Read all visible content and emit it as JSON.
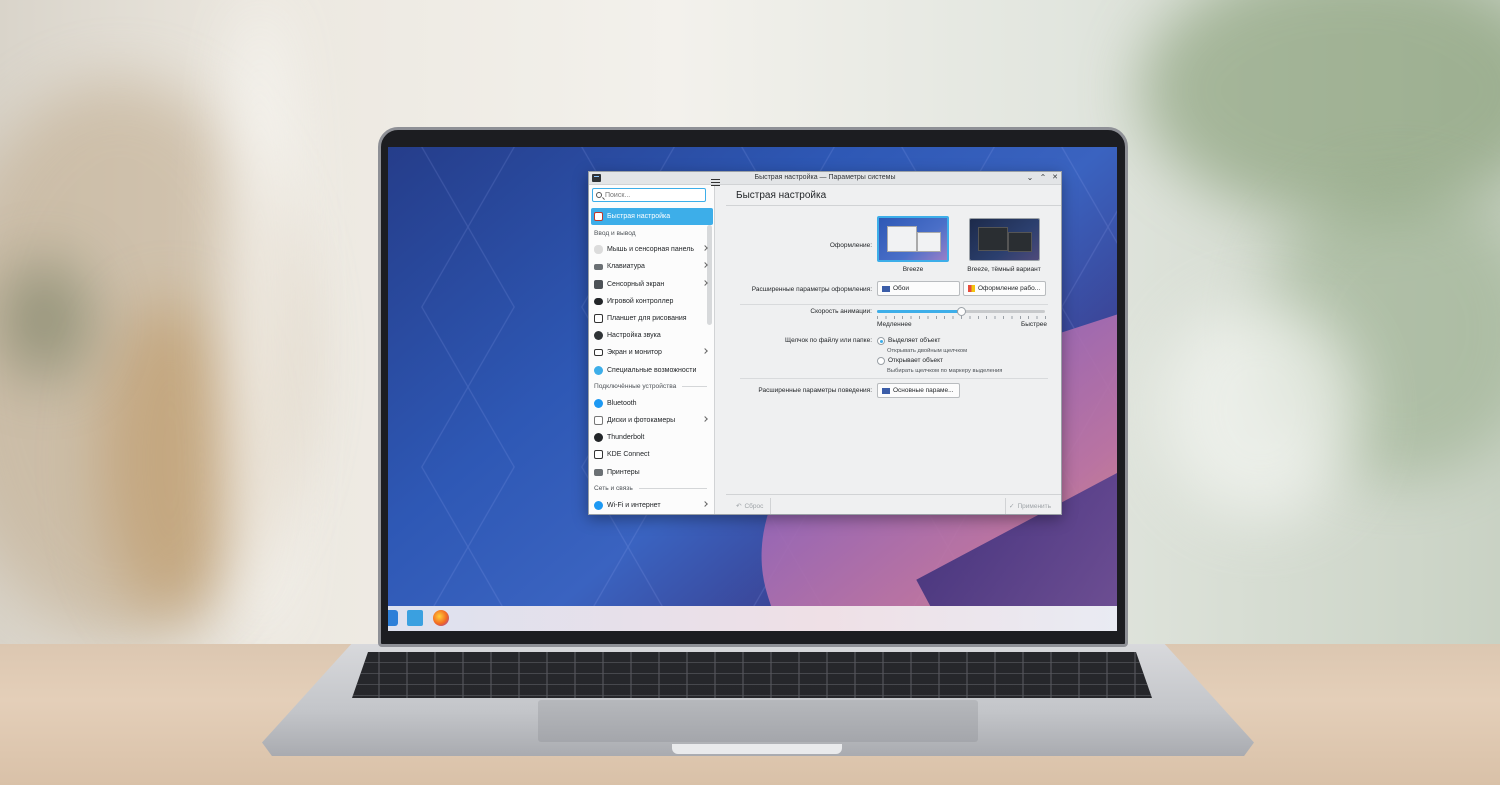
{
  "window": {
    "title": "Быстрая настройка — Параметры системы",
    "minimize": "⌄",
    "maximize": "⌃",
    "close": "✕"
  },
  "search": {
    "placeholder": "Поиск..."
  },
  "sidebar": {
    "active_item": "Быстрая настройка",
    "sections": [
      {
        "title": "Ввод и вывод",
        "items": [
          {
            "label": "Мышь и сенсорная панель",
            "icon": "mouse-icon",
            "has_submenu": true
          },
          {
            "label": "Клавиатура",
            "icon": "keyboard-icon",
            "has_submenu": true
          },
          {
            "label": "Сенсорный экран",
            "icon": "touchscreen-icon",
            "has_submenu": true
          },
          {
            "label": "Игровой контроллер",
            "icon": "gamepad-icon",
            "has_submenu": false
          },
          {
            "label": "Планшет для рисования",
            "icon": "tablet-icon",
            "has_submenu": false
          },
          {
            "label": "Настройка звука",
            "icon": "speaker-icon",
            "has_submenu": false
          },
          {
            "label": "Экран и монитор",
            "icon": "monitor-icon",
            "has_submenu": true
          },
          {
            "label": "Специальные возможности",
            "icon": "accessibility-icon",
            "has_submenu": false
          }
        ]
      },
      {
        "title": "Подключённые устройства",
        "items": [
          {
            "label": "Bluetooth",
            "icon": "bluetooth-icon",
            "has_submenu": false
          },
          {
            "label": "Диски и фотокамеры",
            "icon": "disk-icon",
            "has_submenu": true
          },
          {
            "label": "Thunderbolt",
            "icon": "thunderbolt-icon",
            "has_submenu": false
          },
          {
            "label": "KDE Connect",
            "icon": "kdeconnect-icon",
            "has_submenu": false
          },
          {
            "label": "Принтеры",
            "icon": "printer-icon",
            "has_submenu": false
          }
        ]
      },
      {
        "title": "Сеть и связь",
        "items": [
          {
            "label": "Wi-Fi и интернет",
            "icon": "wifi-icon",
            "has_submenu": true
          }
        ]
      }
    ]
  },
  "content": {
    "page_title": "Быстрая настройка",
    "appearance_label": "Оформление:",
    "themes": [
      {
        "name": "Breeze",
        "selected": true
      },
      {
        "name": "Breeze, тёмный вариант",
        "selected": false
      }
    ],
    "advanced_appearance_label": "Расширенные параметры оформления:",
    "wallpaper_button": "Обои",
    "desktop_theme_button": "Оформление рабо...",
    "animation_label": "Скорость анимации:",
    "animation_slow": "Медленнее",
    "animation_fast": "Быстрее",
    "animation_level": 0.5,
    "click_label": "Щелчок по файлу или папке:",
    "click_options": [
      {
        "label": "Выделяет объект",
        "hint": "Открывать двойным щелчком",
        "checked": true
      },
      {
        "label": "Открывает объект",
        "hint": "Выбирать щелчком по маркеру выделения",
        "checked": false
      }
    ],
    "advanced_behavior_label": "Расширенные параметры поведения:",
    "behavior_button": "Основные параме..."
  },
  "footer": {
    "reset": "Сброс",
    "apply": "Применить"
  },
  "colors": {
    "accent": "#3daee9",
    "window_bg": "#eff0f1",
    "sidebar_bg": "#fcfcfc"
  }
}
